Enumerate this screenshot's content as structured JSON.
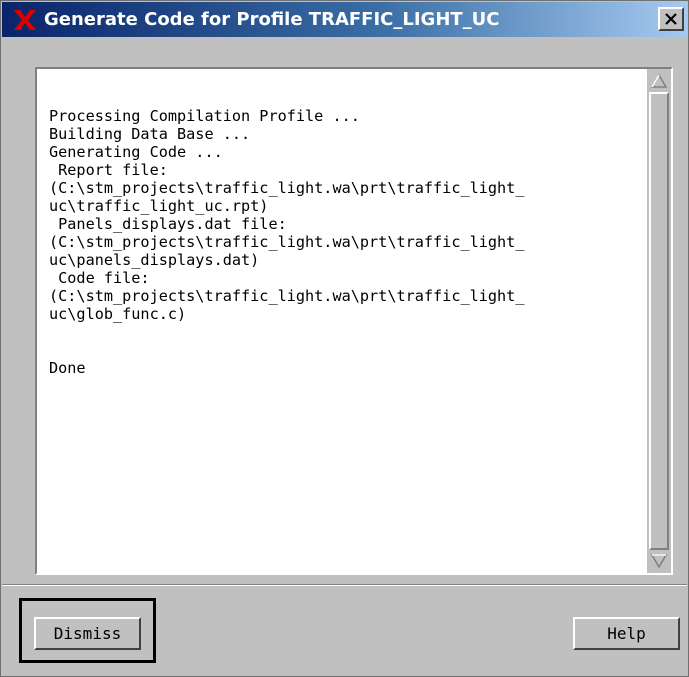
{
  "window": {
    "title": "Generate Code for Profile TRAFFIC_LIGHT_UC",
    "app_icon": "x-logo-icon",
    "close_icon": "close-icon",
    "close_glyph": "×"
  },
  "output": {
    "lines": [
      "Processing Compilation Profile ...",
      "Building Data Base ...",
      "Generating Code ...",
      " Report file:",
      "(C:\\stm_projects\\traffic_light.wa\\prt\\traffic_light_",
      "uc\\traffic_light_uc.rpt)",
      " Panels_displays.dat file:",
      "(C:\\stm_projects\\traffic_light.wa\\prt\\traffic_light_",
      "uc\\panels_displays.dat)",
      " Code file:",
      "(C:\\stm_projects\\traffic_light.wa\\prt\\traffic_light_",
      "uc\\glob_func.c)",
      "",
      "",
      "Done"
    ]
  },
  "scrollbar": {
    "up_icon": "scroll-up-arrow-icon",
    "down_icon": "scroll-down-arrow-icon"
  },
  "buttons": {
    "dismiss_label": "Dismiss",
    "help_label": "Help"
  },
  "colors": {
    "title_gradient_start": "#0a246a",
    "title_gradient_end": "#a6caf0",
    "dialog_bg": "#c0c0c0",
    "icon_red": "#e00000"
  }
}
